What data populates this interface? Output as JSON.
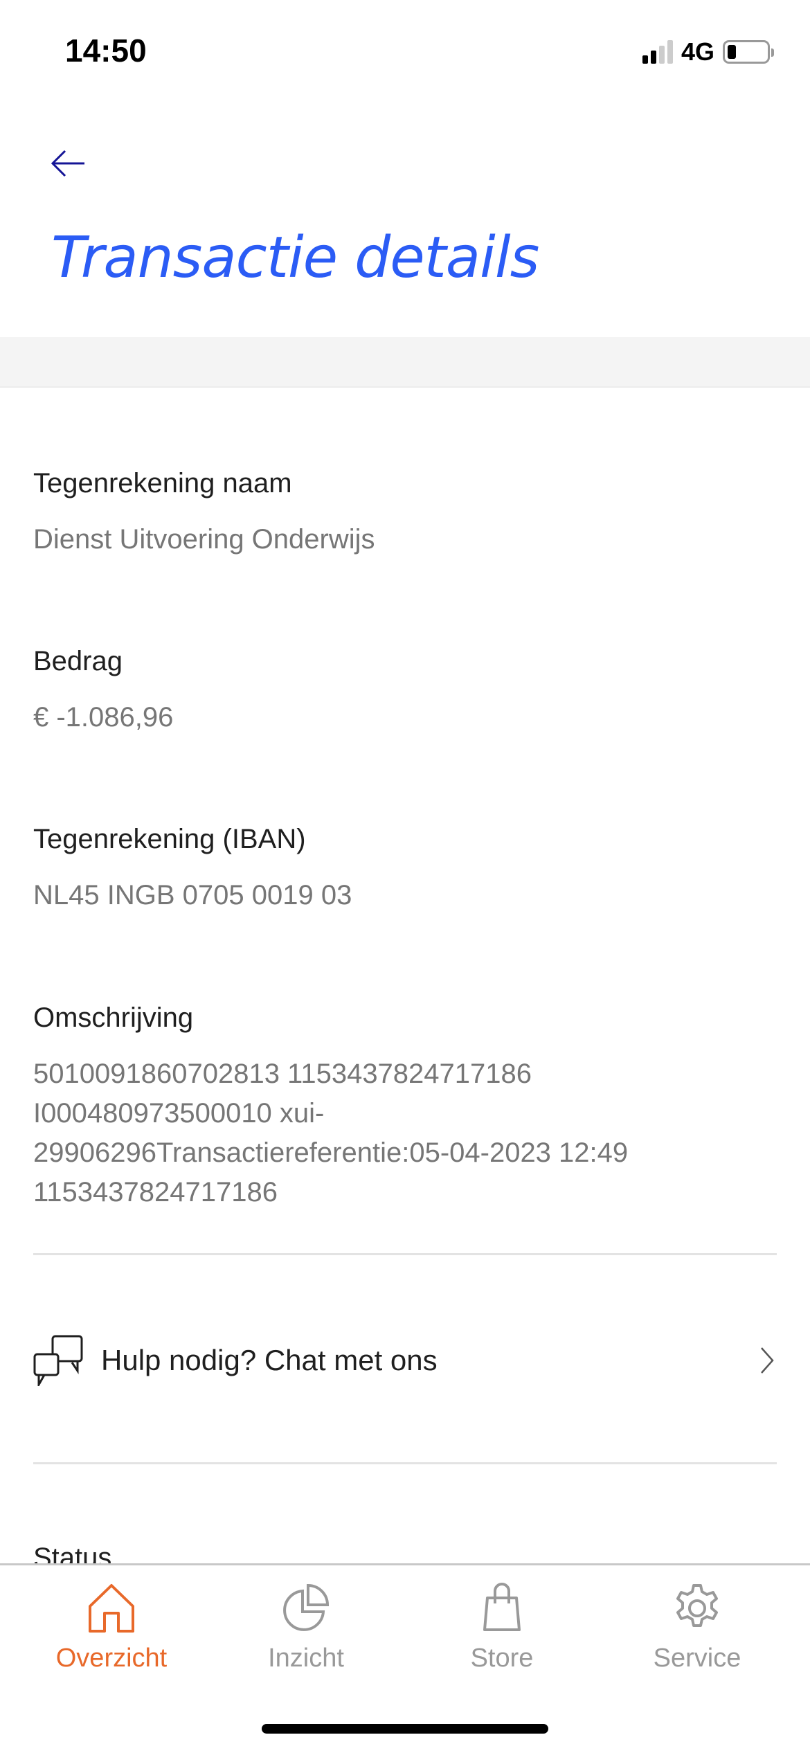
{
  "status_bar": {
    "time": "14:50",
    "network": "4G",
    "signal_bars_active": 2,
    "signal_bars_total": 4
  },
  "header": {
    "title": "Transactie details"
  },
  "fields": [
    {
      "label": "Tegenrekening naam",
      "value": "Dienst Uitvoering Onderwijs"
    },
    {
      "label": "Bedrag",
      "value": "€ -1.086,96"
    },
    {
      "label": "Tegenrekening (IBAN)",
      "value": "NL45 INGB 0705 0019 03"
    },
    {
      "label": "Omschrijving",
      "lines": [
        "5010091860702813 1153437824717186",
        "I000480973500010 xui-",
        "29906296Transactiereferentie:05-04-2023 12:49",
        "1153437824717186"
      ]
    }
  ],
  "chat": {
    "label": "Hulp nodig? Chat met ons"
  },
  "status_label": "Status",
  "tabs": [
    {
      "label": "Overzicht",
      "active": true
    },
    {
      "label": "Inzicht"
    },
    {
      "label": "Store"
    },
    {
      "label": "Service"
    }
  ],
  "colors": {
    "accent": "#e8692a",
    "title": "#2b5cf5",
    "inactive": "#999999"
  }
}
